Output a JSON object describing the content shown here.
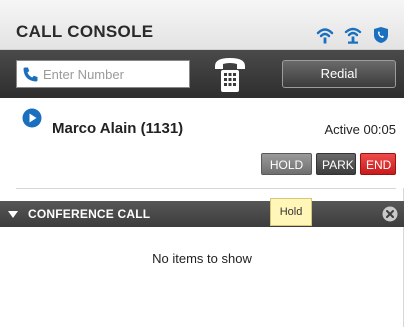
{
  "header": {
    "title": "CALL CONSOLE",
    "icons": [
      "wifi-signal-icon",
      "agent-status-icon",
      "phone-shield-icon"
    ]
  },
  "toolbar": {
    "number_placeholder": "Enter Number",
    "redial_label": "Redial"
  },
  "active_call": {
    "caller": "Marco Alain (1131)",
    "status": "Active 00:05",
    "actions": {
      "hold": "HOLD",
      "park": "PARK",
      "end": "END"
    }
  },
  "conference": {
    "title": "CONFERENCE CALL",
    "empty_message": "No items to show"
  },
  "tooltip": {
    "text": "Hold"
  },
  "colors": {
    "accent_blue": "#1a6fbf",
    "end_red": "#d92323",
    "toolbar_dark": "#3a3a3a",
    "tooltip_yellow": "#fff6b8"
  }
}
